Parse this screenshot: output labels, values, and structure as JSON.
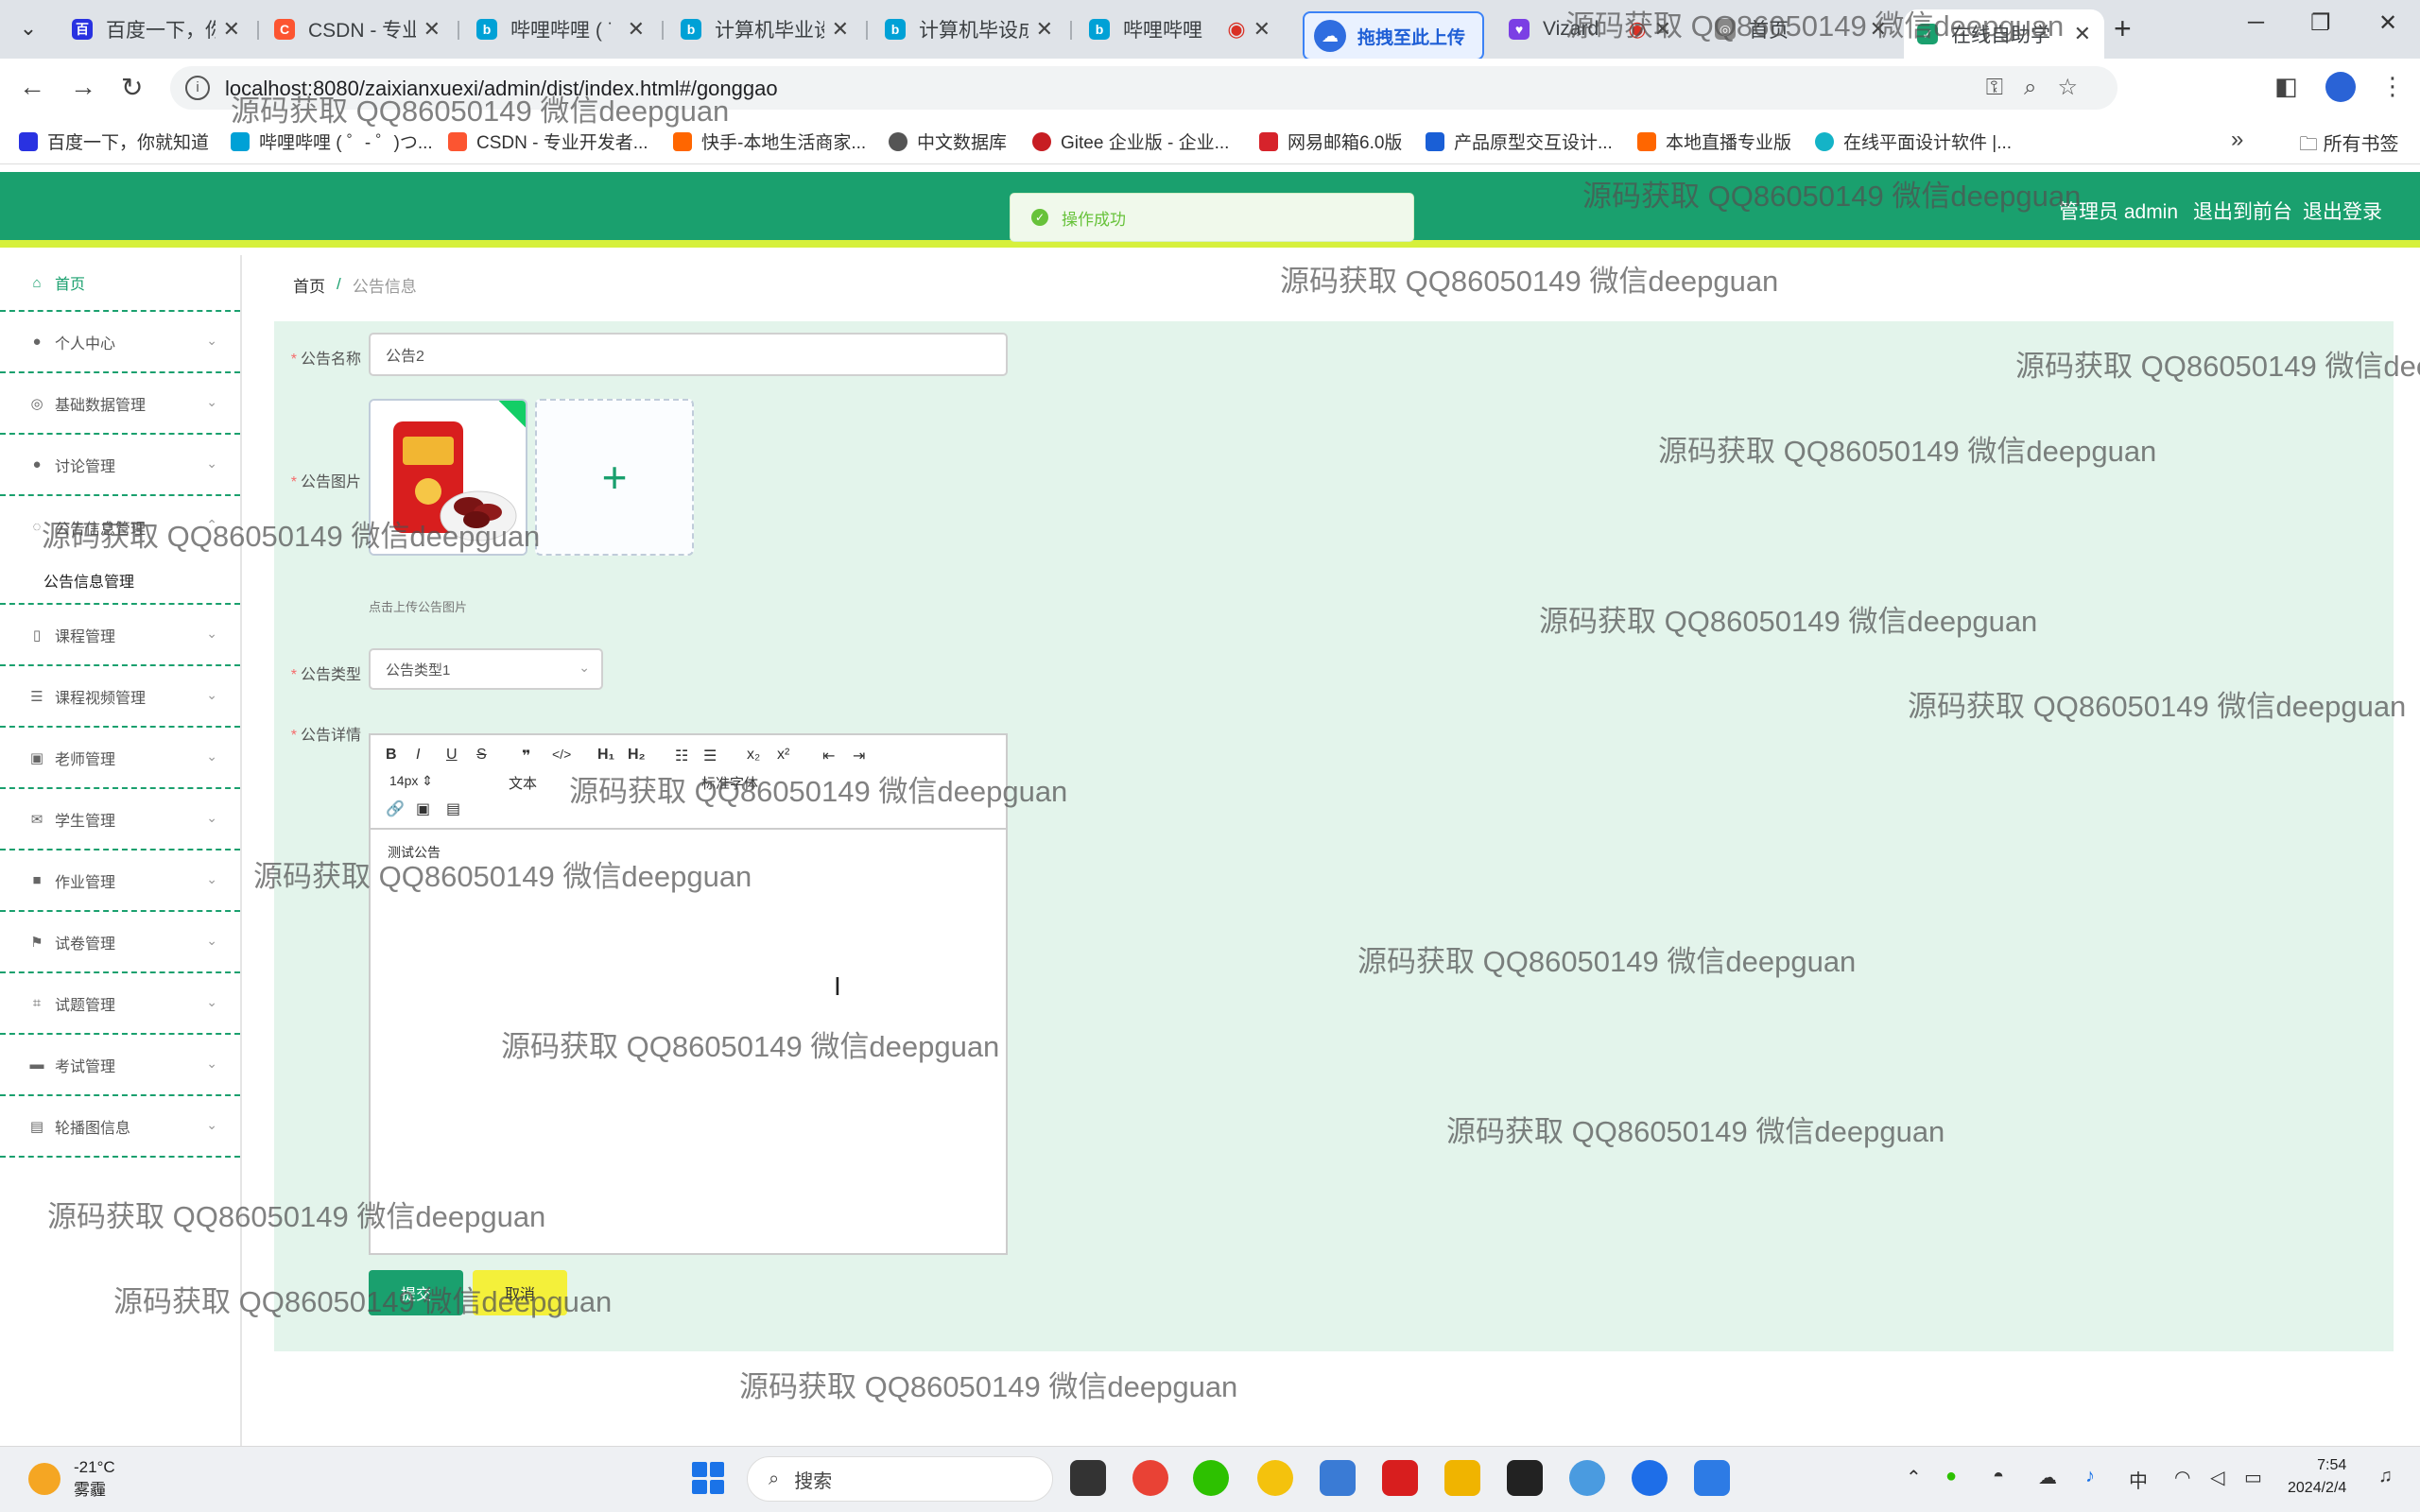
{
  "browser": {
    "tabs": [
      {
        "title": "百度一下，你",
        "color": "#2932e1"
      },
      {
        "title": "CSDN - 专业",
        "color": "#fc5531"
      },
      {
        "title": "哔哩哔哩 ( ˙",
        "color": "#00a1d6"
      },
      {
        "title": "计算机毕业设",
        "color": "#00a1d6"
      },
      {
        "title": "计算机毕设成",
        "color": "#00a1d6"
      },
      {
        "title": "哔哩哔哩",
        "color": "#00a1d6"
      },
      {
        "title": "Vizard",
        "color": "#7b3fe4"
      },
      {
        "title": "首页",
        "color": "#888888"
      },
      {
        "title": "在线自助学",
        "color": "#1aa06e"
      }
    ],
    "upload_button": "拖拽至此上传",
    "url": "localhost:8080/zaixianxuexi/admin/dist/index.html#/gonggao",
    "bookmarks": [
      {
        "label": "百度一下，你就知道",
        "color": "#2932e1"
      },
      {
        "label": "哔哩哔哩 ( ゜- ゜)つ...",
        "color": "#00a1d6"
      },
      {
        "label": "CSDN - 专业开发者...",
        "color": "#fc5531"
      },
      {
        "label": "快手-本地生活商家...",
        "color": "#ff6600"
      },
      {
        "label": "中文数据库",
        "color": "#555555"
      },
      {
        "label": "Gitee 企业版 - 企业...",
        "color": "#c71d23"
      },
      {
        "label": "网易邮箱6.0版",
        "color": "#d6232b"
      },
      {
        "label": "产品原型交互设计...",
        "color": "#1a5fd6"
      },
      {
        "label": "本地直播专业版",
        "color": "#ff6600"
      },
      {
        "label": "在线平面设计软件 |...",
        "color": "#14b3c7"
      }
    ],
    "all_bookmarks": "所有书签"
  },
  "header": {
    "admin_label": "管理员 admin",
    "back_front": "退出到前台",
    "logout": "退出登录",
    "toast": "操作成功"
  },
  "sidebar": {
    "items": [
      {
        "label": "首页",
        "icon": "home-icon"
      },
      {
        "label": "个人中心",
        "icon": "user-icon"
      },
      {
        "label": "基础数据管理",
        "icon": "data-icon"
      },
      {
        "label": "讨论管理",
        "icon": "discussion-icon"
      },
      {
        "label": "公告信息管理",
        "icon": "notice-icon"
      },
      {
        "label": "课程管理",
        "icon": "course-icon"
      },
      {
        "label": "课程视频管理",
        "icon": "video-icon"
      },
      {
        "label": "老师管理",
        "icon": "teacher-icon"
      },
      {
        "label": "学生管理",
        "icon": "student-icon"
      },
      {
        "label": "作业管理",
        "icon": "homework-icon"
      },
      {
        "label": "试卷管理",
        "icon": "paper-icon"
      },
      {
        "label": "试题管理",
        "icon": "question-icon"
      },
      {
        "label": "考试管理",
        "icon": "exam-icon"
      },
      {
        "label": "轮播图信息",
        "icon": "carousel-icon"
      }
    ],
    "submenu_active": "公告信息管理"
  },
  "breadcrumb": {
    "home": "首页",
    "sep": "/",
    "current": "公告信息"
  },
  "form": {
    "name_label": "公告名称",
    "name_value": "公告2",
    "image_label": "公告图片",
    "upload_tip": "点击上传公告图片",
    "type_label": "公告类型",
    "type_value": "公告类型1",
    "detail_label": "公告详情",
    "detail_text": "测试公告",
    "editor_font_size": "14px",
    "editor_para": "文本",
    "editor_family": "标准字体",
    "submit_label": "提交",
    "cancel_label": "取消"
  },
  "taskbar": {
    "temperature": "-21°C",
    "weather": "雾霾",
    "search_placeholder": "搜索",
    "time": "7:54",
    "date": "2024/2/4"
  },
  "watermark": "源码获取 QQ86050149 微信deepguan"
}
